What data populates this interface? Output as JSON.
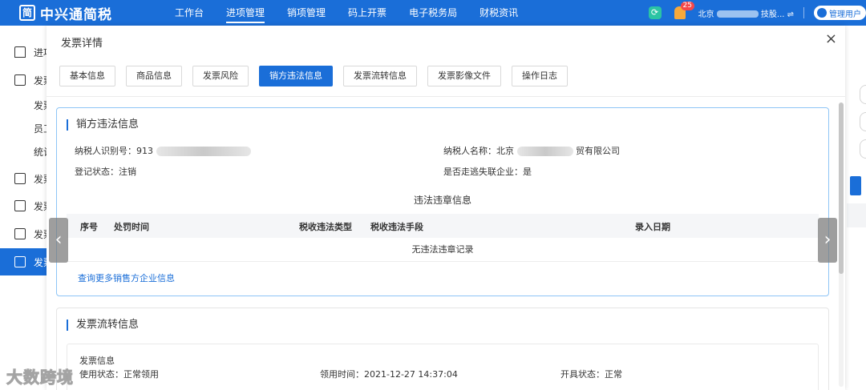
{
  "app": {
    "logo_glyph": "简",
    "title": "中兴通简税"
  },
  "nav": [
    {
      "label": "工作台",
      "active": false
    },
    {
      "label": "进项管理",
      "active": true
    },
    {
      "label": "销项管理",
      "active": false
    },
    {
      "label": "码上开票",
      "active": false
    },
    {
      "label": "电子税务局",
      "active": false
    },
    {
      "label": "财税资讯",
      "active": false
    }
  ],
  "header_right": {
    "notification_count": "25",
    "company_prefix": "北京",
    "company_suffix": "技股... ⇌",
    "user_label": "管理用户"
  },
  "sidebar": [
    {
      "label": "进项",
      "icon": "home-icon"
    },
    {
      "label": "发票",
      "icon": "edit-icon"
    },
    {
      "label": "发票",
      "sub": true
    },
    {
      "label": "员工",
      "sub": true
    },
    {
      "label": "统计",
      "sub": true
    },
    {
      "label": "发票",
      "icon": "check-icon"
    },
    {
      "label": "发票",
      "icon": "grid-icon"
    },
    {
      "label": "发票",
      "icon": "search-doc-icon"
    },
    {
      "label": "发票",
      "icon": "chart-icon",
      "active": true
    }
  ],
  "modal": {
    "title": "发票详情",
    "close": "×",
    "tabs": [
      {
        "label": "基本信息",
        "active": false
      },
      {
        "label": "商品信息",
        "active": false
      },
      {
        "label": "发票风险",
        "active": false
      },
      {
        "label": "销方违法信息",
        "active": true
      },
      {
        "label": "发票流转信息",
        "active": false
      },
      {
        "label": "发票影像文件",
        "active": false
      },
      {
        "label": "操作日志",
        "active": false
      }
    ],
    "seller_section": {
      "title": "销方违法信息",
      "taxpayer_id_label": "纳税人识别号：",
      "taxpayer_id_visible": "913",
      "taxpayer_name_label": "纳税人名称：",
      "taxpayer_name_prefix": "北京",
      "taxpayer_name_suffix": "贸有限公司",
      "reg_status_label": "登记状态：",
      "reg_status_value": "注销",
      "abnormal_label": "是否走逃失联企业：",
      "abnormal_value": "是",
      "violation_title": "违法违章信息",
      "table_headers": [
        "序号",
        "处罚时间",
        "税收违法类型",
        "税收违法手段",
        "录入日期"
      ],
      "empty_text": "无违法违章记录",
      "more_link": "查询更多销售方企业信息"
    },
    "flow_section": {
      "title": "发票流转信息",
      "subheader": "发票信息",
      "use_status_label": "使用状态：",
      "use_status_value": "正常领用",
      "use_time_label": "领用时间：",
      "use_time_value": "2021-12-27 14:37:04",
      "issue_status_label": "开具状态：",
      "issue_status_value": "正常"
    }
  },
  "arrows": {
    "prev": "‹",
    "next": "›"
  },
  "watermark": "大数跨境"
}
